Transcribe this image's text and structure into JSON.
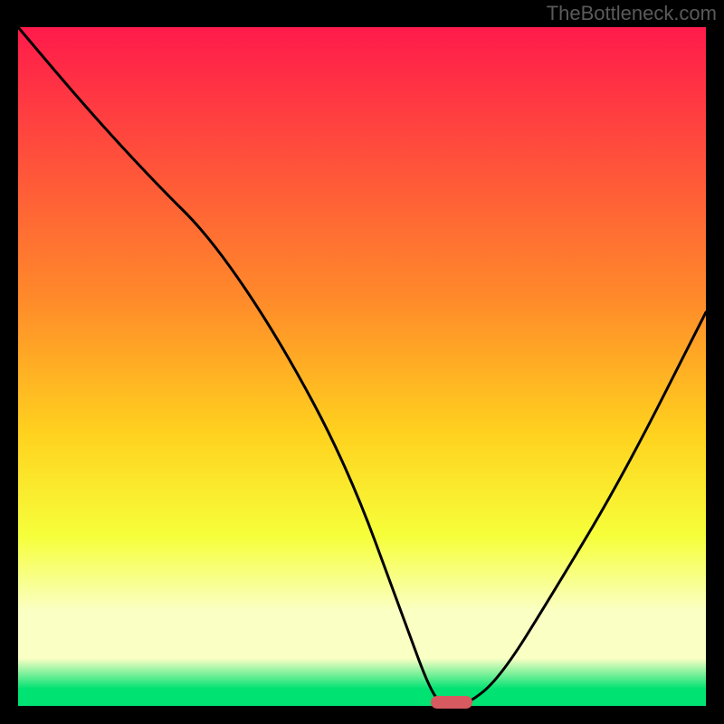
{
  "attribution": "TheBottleneck.com",
  "colors": {
    "top": "#ff1a4b",
    "upper_mid": "#ff8a2a",
    "mid": "#ffd21e",
    "lower_mid": "#f6ff3a",
    "pale": "#faffc4",
    "bottom": "#00e272",
    "marker": "#d65a5f",
    "curve": "#000000",
    "page_bg": "#000000"
  },
  "chart_data": {
    "type": "line",
    "title": "",
    "xlabel": "",
    "ylabel": "",
    "xlim": [
      0,
      100
    ],
    "ylim": [
      0,
      100
    ],
    "grid": false,
    "series": [
      {
        "name": "bottleneck-curve",
        "x": [
          0,
          10,
          20,
          28,
          38,
          48,
          56,
          60,
          62,
          65,
          70,
          78,
          88,
          100
        ],
        "y": [
          100,
          88,
          77,
          69,
          54,
          35,
          13,
          2,
          0,
          0,
          4,
          17,
          34,
          58
        ]
      }
    ],
    "optimum_marker": {
      "x_start": 60,
      "x_end": 66,
      "y": 0
    },
    "gradient_stops_pct": [
      0,
      40,
      60,
      75,
      86,
      93,
      97.5,
      100
    ]
  }
}
